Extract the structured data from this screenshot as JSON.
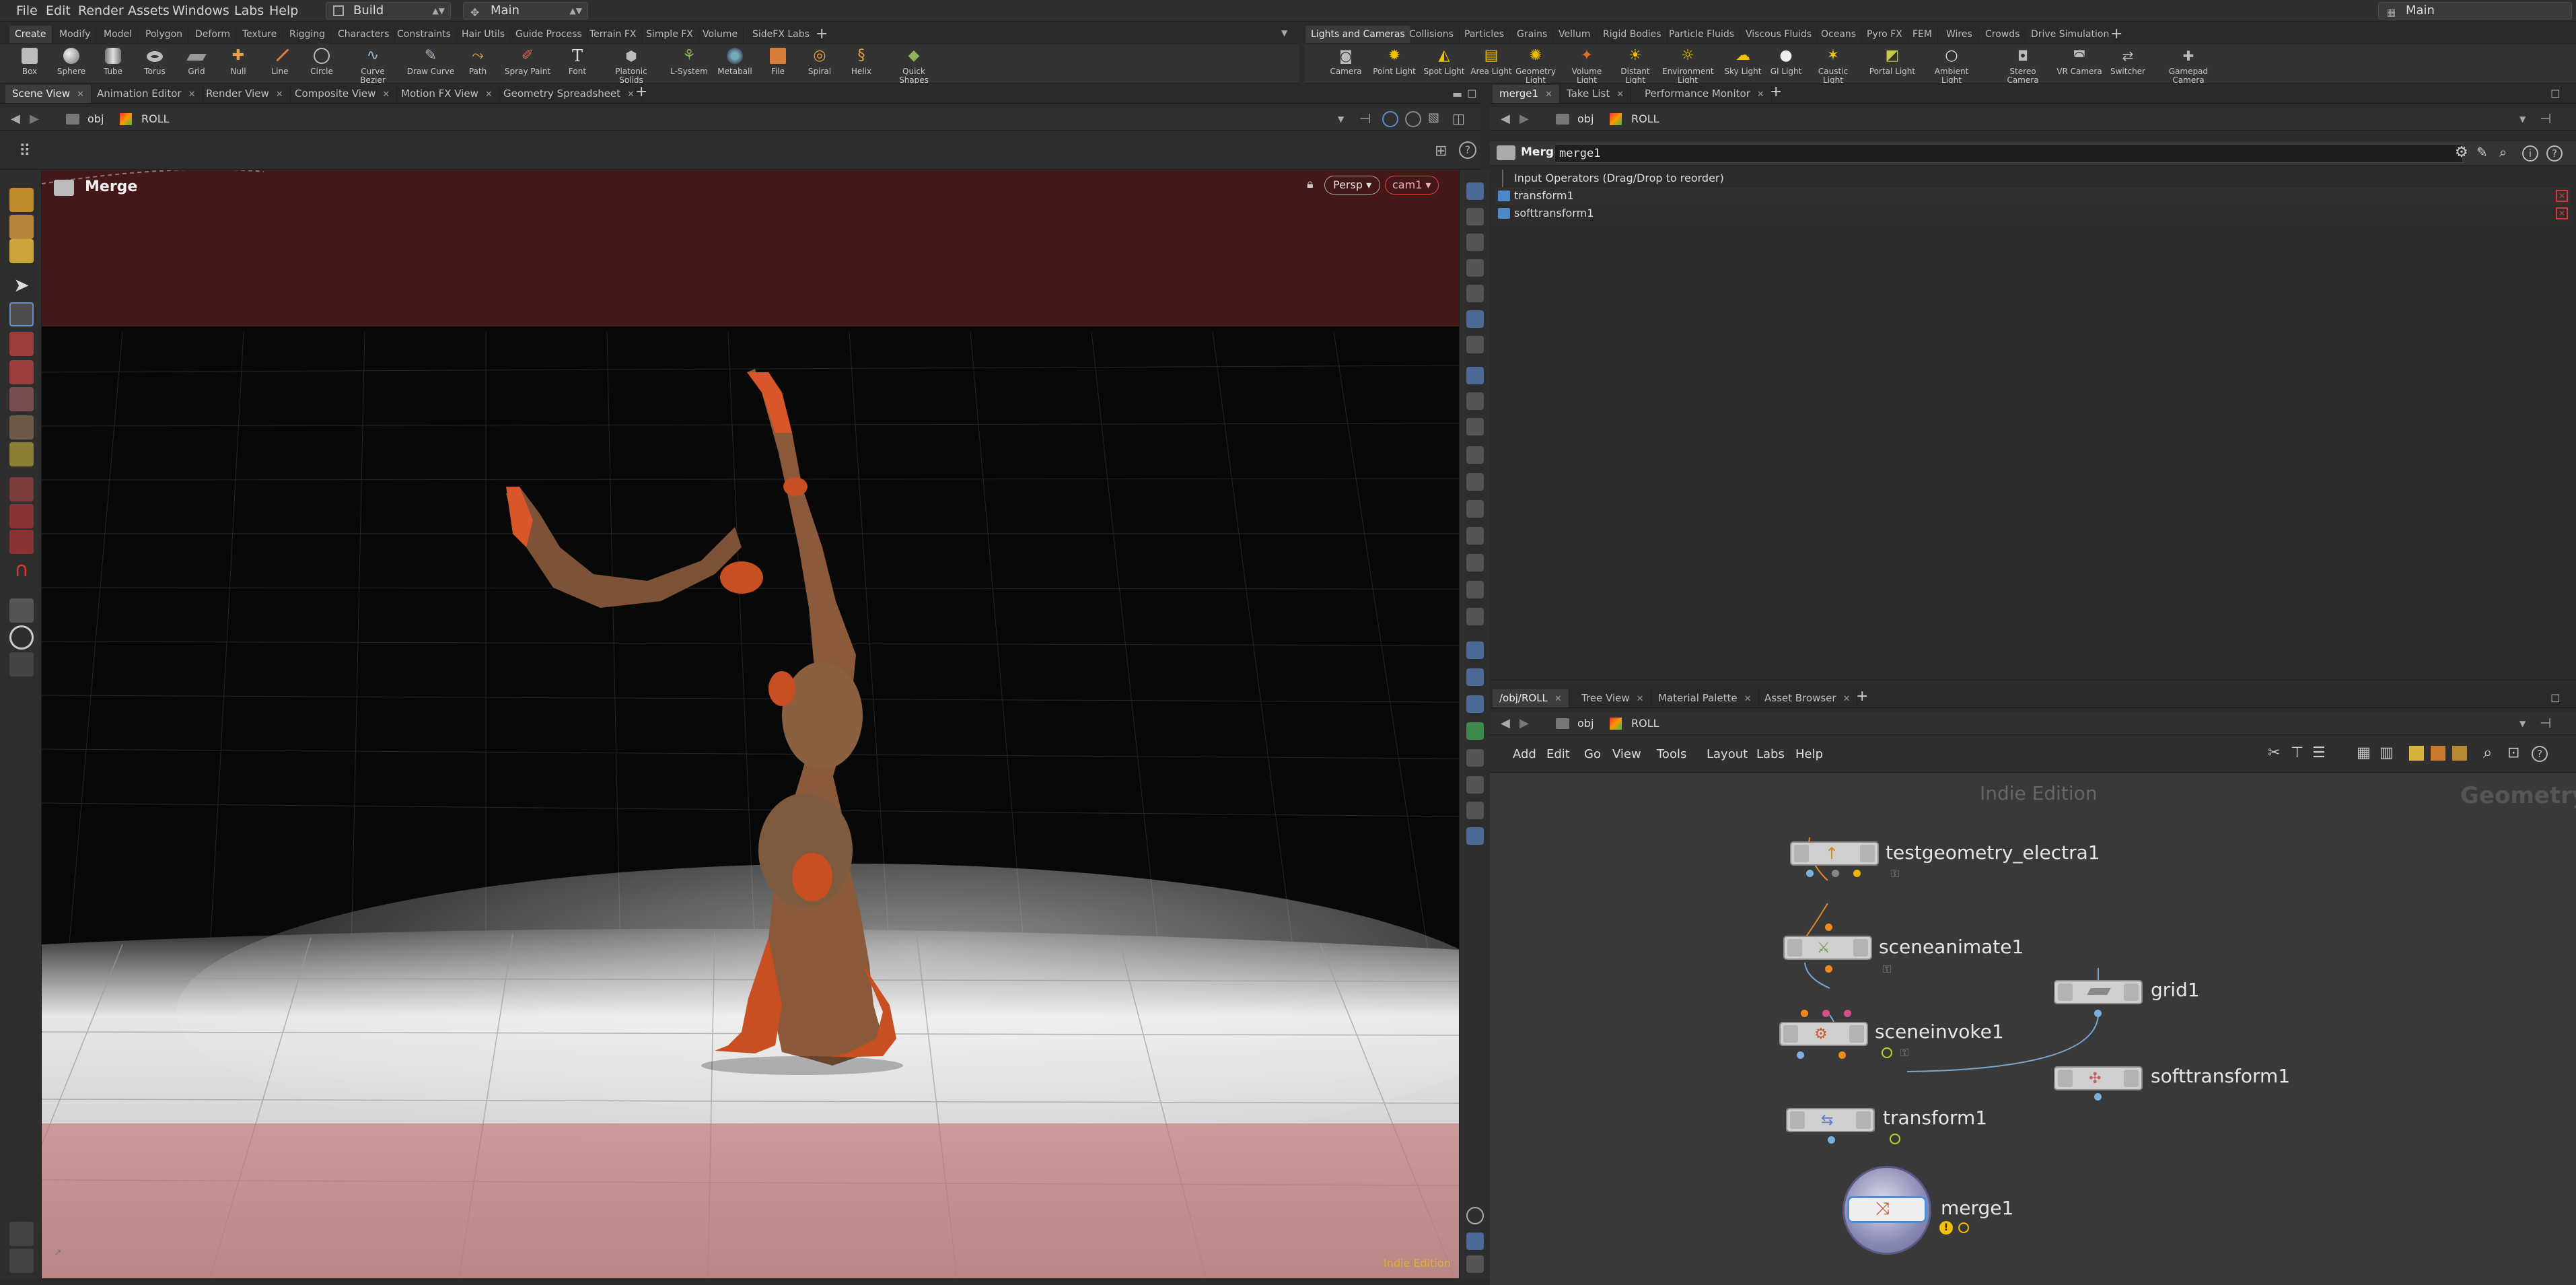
{
  "menubar": {
    "items": [
      "File",
      "Edit",
      "Render",
      "Assets",
      "Windows",
      "Labs",
      "Help"
    ],
    "desktop": "Build",
    "context": "Main",
    "right_context": "Main"
  },
  "shelf_left": {
    "tabs": [
      "Create",
      "Modify",
      "Model",
      "Polygon",
      "Deform",
      "Texture",
      "Rigging",
      "Characters",
      "Constraints",
      "Hair Utils",
      "Guide Process",
      "Terrain FX",
      "Simple FX",
      "Volume",
      "SideFX Labs"
    ],
    "tools": [
      "Box",
      "Sphere",
      "Tube",
      "Torus",
      "Grid",
      "Null",
      "Line",
      "Circle",
      "Curve Bezier",
      "Draw Curve",
      "Path",
      "Spray Paint",
      "Font",
      "Platonic Solids",
      "L-System",
      "Metaball",
      "File",
      "Spiral",
      "Helix",
      "Quick Shapes"
    ]
  },
  "shelf_right": {
    "tabs": [
      "Lights and Cameras",
      "Collisions",
      "Particles",
      "Grains",
      "Vellum",
      "Rigid Bodies",
      "Particle Fluids",
      "Viscous Fluids",
      "Oceans",
      "Pyro FX",
      "FEM",
      "Wires",
      "Crowds",
      "Drive Simulation"
    ],
    "tools": [
      "Camera",
      "Point Light",
      "Spot Light",
      "Area Light",
      "Geometry Light",
      "Volume Light",
      "Distant Light",
      "Environment Light",
      "Sky Light",
      "GI Light",
      "Caustic Light",
      "Portal Light",
      "Ambient Light",
      "Stereo Camera",
      "VR Camera",
      "Switcher",
      "Gamepad Camera"
    ]
  },
  "left_pane": {
    "tabs": [
      "Scene View",
      "Animation Editor",
      "Render View",
      "Composite View",
      "Motion FX View",
      "Geometry Spreadsheet"
    ],
    "path": [
      "obj",
      "ROLL"
    ]
  },
  "viewport": {
    "node_name": "Merge",
    "view_mode": "Persp",
    "camera": "cam1",
    "watermark": "Indie Edition"
  },
  "right_top": {
    "tabs": [
      "merge1",
      "Take List",
      "Performance Monitor"
    ],
    "path": [
      "obj",
      "ROLL"
    ],
    "node_type": "Merge",
    "node_name": "merge1",
    "input_header": "Input Operators (Drag/Drop to reorder)",
    "inputs": [
      "transform1",
      "softtransform1"
    ]
  },
  "right_bottom": {
    "tabs": [
      "/obj/ROLL",
      "Tree View",
      "Material Palette",
      "Asset Browser"
    ],
    "path": [
      "obj",
      "ROLL"
    ],
    "menu": [
      "Add",
      "Edit",
      "Go",
      "View",
      "Tools",
      "Layout",
      "Labs",
      "Help"
    ],
    "watermark": "Indie Edition",
    "context_label": "Geometry",
    "nodes": [
      "testgeometry_electra1",
      "sceneanimate1",
      "sceneinvoke1",
      "grid1",
      "transform1",
      "softtransform1",
      "merge1"
    ]
  },
  "colors": {
    "accent_orange": "#f0932b",
    "selection_blue": "#4a90d9",
    "node_yellow": "#f2c200",
    "error_red": "#d43a3a"
  }
}
